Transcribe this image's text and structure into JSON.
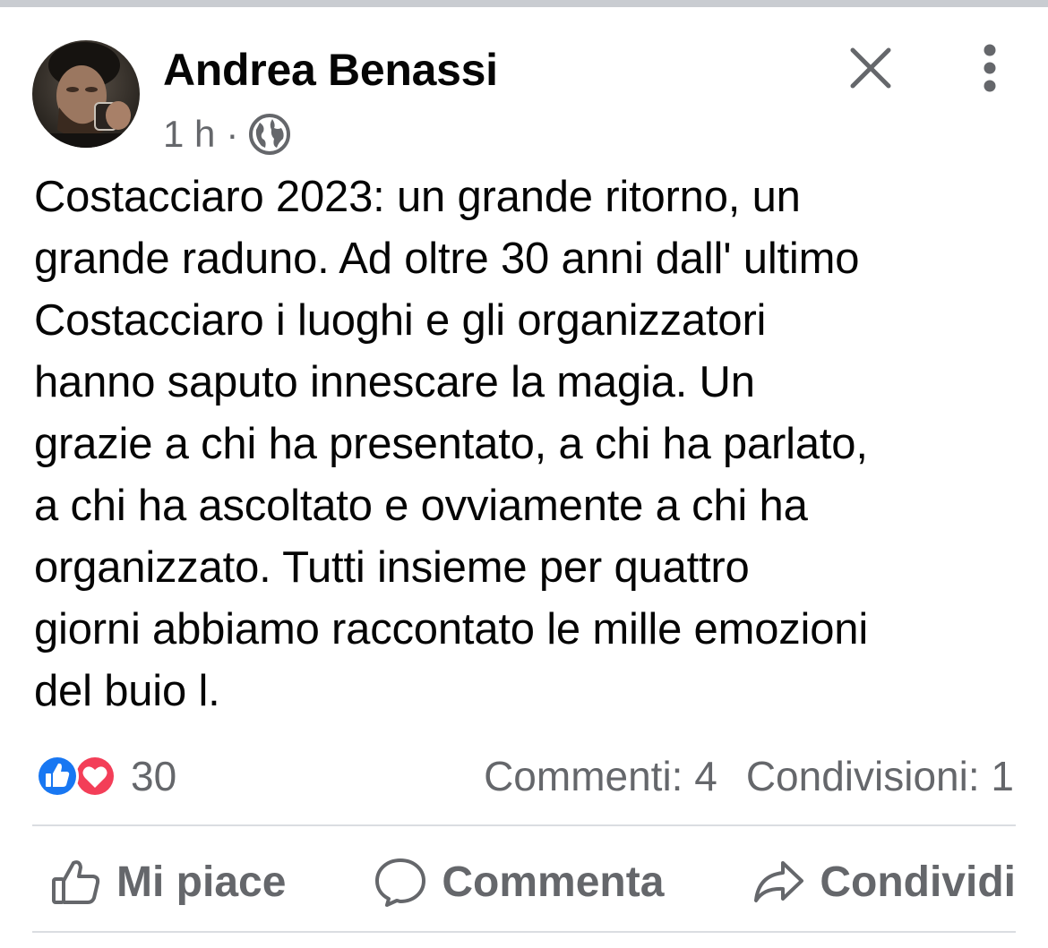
{
  "post": {
    "author": "Andrea Benassi",
    "time": "1 h",
    "separator": "·",
    "audience_icon": "globe-icon",
    "text": "Costacciaro 2023: un grande ritorno, un\ngrande raduno. Ad oltre 30 anni dall' ultimo\nCostacciaro i luoghi e gli organizzatori\nhanno saputo innescare la magia. Un\ngrazie a chi ha presentato, a chi ha parlato,\na chi ha ascoltato e ovviamente a chi ha\norganizzato. Tutti insieme per quattro\ngiorni abbiamo raccontato le mille emozioni\ndel buio l."
  },
  "reactions": {
    "count": "30",
    "icons": [
      "like-icon",
      "love-icon"
    ]
  },
  "stats": {
    "comments": "Commenti: 4",
    "shares": "Condivisioni: 1"
  },
  "actions": {
    "like_label": "Mi piace",
    "comment_label": "Commenta",
    "share_label": "Condividi"
  },
  "colors": {
    "text": "#050505",
    "secondary_text": "#65676b",
    "like_blue": "#1877f2",
    "love_red": "#f33e58",
    "divider": "#dadde1"
  }
}
